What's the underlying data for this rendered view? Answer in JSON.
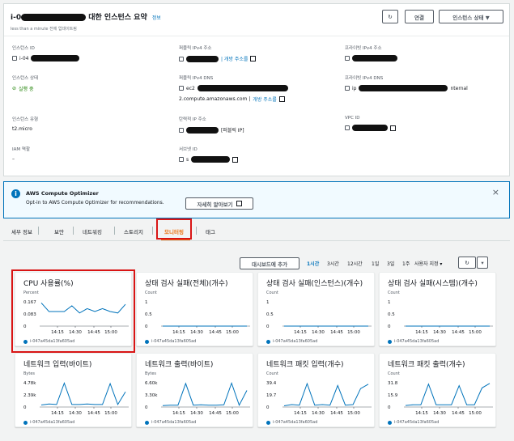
{
  "summary": {
    "title_prefix": "i-0",
    "title_suffix": "대한 인스턴스 요약",
    "info": "정보",
    "subtitle": "less than a minute 전에 업데이트됨",
    "buttons": {
      "refresh": "↻",
      "connect": "연결",
      "state": "인스턴스 상태 ▼"
    },
    "fields": {
      "instance_id_label": "인스턴스 ID",
      "instance_id_prefix": "i-04",
      "instance_state_label": "인스턴스 상태",
      "instance_state": "실행 중",
      "instance_type_label": "인스턴스 유형",
      "instance_type": "t2.micro",
      "iam_label": "IAM 역할",
      "iam_value": "–",
      "public_ipv4_label": "퍼블릭 IPv4 주소",
      "public_ipv4_link": "| 개방 주소를",
      "public_dns_label": "퍼블릭 IPv4 DNS",
      "public_dns_prefix": "ec2",
      "public_dns_suffix": "2.compute.amazonaws.com |",
      "public_dns_link": "개방 주소를",
      "elastic_ip_label": "탄력적 IP 주소",
      "elastic_ip_suffix": "[퍼블릭 IP]",
      "subnet_label": "서브넷 ID",
      "subnet_prefix": "s",
      "private_ipv4_label": "프라이빗 IPv4 주소",
      "private_dns_label": "프라이빗 IPv4 DNS",
      "private_dns_prefix": "ip",
      "private_dns_suffix": "nternal",
      "vpc_label": "VPC ID"
    }
  },
  "optimizer": {
    "title": "AWS Compute Optimizer",
    "body": "Opt-in to AWS Compute Optimizer for recommendations.",
    "button": "자세히 알아보기",
    "close": "×"
  },
  "tabs": [
    "세부 정보",
    "보안",
    "네트워킹",
    "스토리지",
    "모니터링",
    "태그"
  ],
  "monitor": {
    "add_dashboard": "대시보드에 추가",
    "ranges": [
      "1시간",
      "3시간",
      "12시간",
      "1일",
      "3일",
      "1주"
    ],
    "custom": "사용자 지정 ▾",
    "legend": "i-047a45da13fa605ad"
  },
  "charts": [
    {
      "title": "CPU 사용률(%)",
      "unit": "Percent",
      "yticks": [
        "0.167",
        "0.083",
        "0"
      ],
      "xticks": [
        "14:15",
        "14:30",
        "14:45",
        "15:00"
      ],
      "values": [
        0.16,
        0.1,
        0.1,
        0.1,
        0.14,
        0.09,
        0.12,
        0.1,
        0.12,
        0.1,
        0.09,
        0.15
      ]
    },
    {
      "title": "상태 검사 실패(전체)(개수)",
      "unit": "Count",
      "yticks": [
        "1",
        "0.5",
        "0"
      ],
      "xticks": [
        "14:15",
        "14:30",
        "14:45",
        "15:00"
      ],
      "values": [
        0,
        0,
        0,
        0,
        0,
        0,
        0,
        0,
        0,
        0,
        0,
        0
      ]
    },
    {
      "title": "상태 검사 실패(인스턴스)(개수)",
      "unit": "Count",
      "yticks": [
        "1",
        "0.5",
        "0"
      ],
      "xticks": [
        "14:15",
        "14:30",
        "14:45",
        "15:00"
      ],
      "values": [
        0,
        0,
        0,
        0,
        0,
        0,
        0,
        0,
        0,
        0,
        0,
        0
      ]
    },
    {
      "title": "상태 검사 실패(시스템)(개수)",
      "unit": "Count",
      "yticks": [
        "1",
        "0.5",
        "0"
      ],
      "xticks": [
        "14:15",
        "14:30",
        "14:45",
        "15:00"
      ],
      "values": [
        0,
        0,
        0,
        0,
        0,
        0,
        0,
        0,
        0,
        0,
        0,
        0
      ]
    },
    {
      "title": "네트워크 입력(바이트)",
      "unit": "Bytes",
      "yticks": [
        "4.78k",
        "2.39k",
        "0"
      ],
      "xticks": [
        "14:15",
        "14:30",
        "14:45",
        "15:00"
      ],
      "values": [
        0.4,
        0.6,
        0.5,
        4.7,
        0.5,
        0.5,
        0.6,
        0.5,
        0.5,
        4.6,
        0.5,
        3.0
      ]
    },
    {
      "title": "네트워크 출력(바이트)",
      "unit": "Bytes",
      "yticks": [
        "6.60k",
        "3.30k",
        "0"
      ],
      "xticks": [
        "14:15",
        "14:30",
        "14:45",
        "15:00"
      ],
      "values": [
        0.4,
        0.5,
        0.5,
        6.4,
        0.5,
        0.6,
        0.5,
        0.5,
        0.6,
        6.5,
        0.5,
        4.5
      ]
    },
    {
      "title": "네트워크 패킷 입력(개수)",
      "unit": "Count",
      "yticks": [
        "39.4",
        "19.7",
        "0"
      ],
      "xticks": [
        "14:15",
        "14:30",
        "14:45",
        "15:00"
      ],
      "values": [
        2,
        4,
        3,
        38,
        3,
        4,
        3,
        35,
        3,
        4,
        30,
        37
      ]
    },
    {
      "title": "네트워크 패킷 출력(개수)",
      "unit": "Count",
      "yticks": [
        "31.8",
        "15.9",
        "0"
      ],
      "xticks": [
        "14:15",
        "14:30",
        "14:45",
        "15:00"
      ],
      "values": [
        2,
        3,
        3,
        30,
        3,
        3,
        3,
        28,
        3,
        3,
        25,
        31
      ]
    }
  ]
}
